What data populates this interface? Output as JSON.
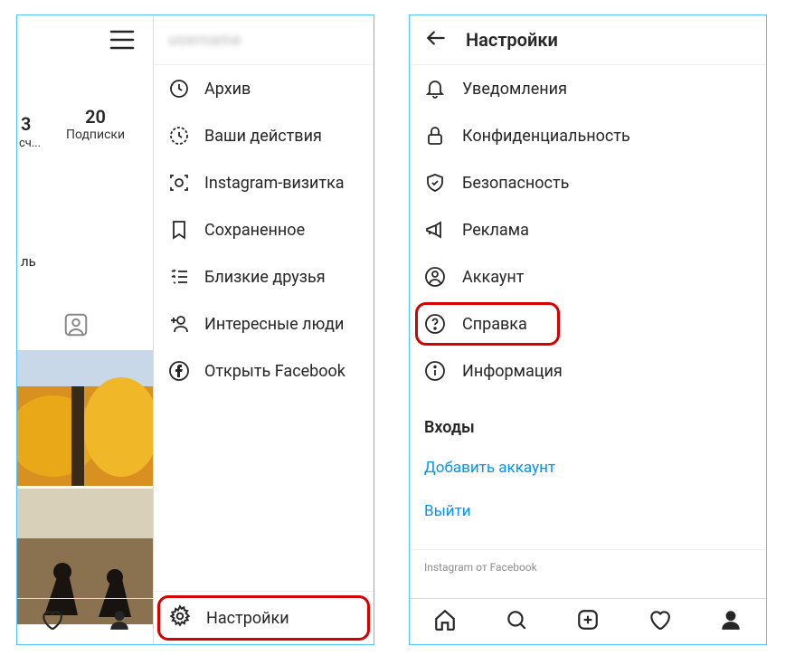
{
  "left": {
    "username": "username",
    "frag_count": "3",
    "frag_label": "сч...",
    "subs_count": "20",
    "subs_label": "Подписки",
    "btn_fragment": "ль",
    "menu": {
      "archive": "Архив",
      "activity": "Ваши действия",
      "nametag": "Instagram-визитка",
      "saved": "Сохраненное",
      "close_friends": "Близкие друзья",
      "discover": "Интересные люди",
      "open_fb": "Открыть Facebook"
    },
    "settings_label": "Настройки"
  },
  "right": {
    "title": "Настройки",
    "items": {
      "notifications": "Уведомления",
      "privacy": "Конфиденциальность",
      "security": "Безопасность",
      "ads": "Реклама",
      "account": "Аккаунт",
      "help": "Справка",
      "about": "Информация"
    },
    "logins_header": "Входы",
    "add_account": "Добавить аккаунт",
    "logout": "Выйти",
    "footer": "Instagram от Facebook"
  },
  "colors": {
    "highlight": "#d40000",
    "link": "#0095f6",
    "border": "#4fc4ff"
  }
}
